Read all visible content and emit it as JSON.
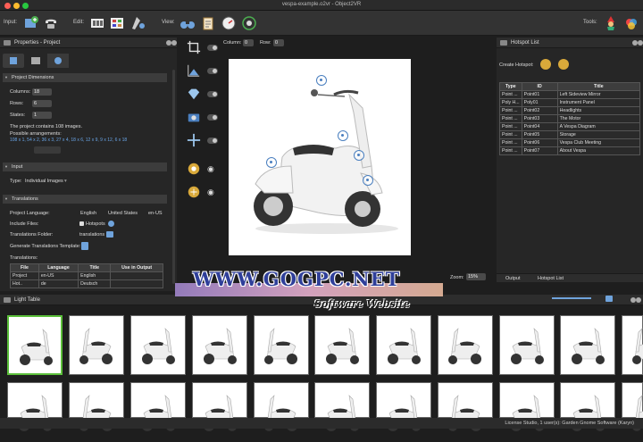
{
  "window": {
    "title": "vespa-example.o2vr - Object2VR"
  },
  "toolbar": {
    "input_label": "Input:",
    "edit_label": "Edit:",
    "view_label": "View:",
    "tools_label": "Tools:"
  },
  "properties": {
    "panel_title": "Properties - Project",
    "dimensions": {
      "heading": "Project Dimensions",
      "columns_label": "Columns:",
      "columns_value": "18",
      "rows_label": "Rows:",
      "rows_value": "6",
      "states_label": "States:",
      "states_value": "1",
      "count_text": "The project contains 108 images.",
      "arrangements_label": "Possible arrangements:",
      "arrangements": "108 x 1, 54 x 2, 36 x 3, 27 x 4, 18 x 6, 12 x 9, 9 x 12, 6 x 18"
    },
    "input": {
      "heading": "Input",
      "type_label": "Type:",
      "type_value": "Individual Images"
    },
    "translations": {
      "heading": "Translations",
      "language_label": "Project Language:",
      "language_value": "English",
      "country_value": "United States",
      "locale_value": "en-US",
      "include_label": "Include Files:",
      "include_value": "Hotspots",
      "folder_label": "Translations Folder:",
      "folder_value": "translations",
      "template_label": "Generate Translations Template:",
      "table_label": "Translations:",
      "columns": [
        "File",
        "Language",
        "Title",
        "Use in Output"
      ],
      "rows": [
        [
          "Project",
          "en-US",
          "English",
          ""
        ],
        [
          "Hot..",
          "de",
          "Deutsch",
          ""
        ]
      ]
    }
  },
  "viewer": {
    "columns_label": "Column:",
    "columns_value": "0",
    "row_label": "Row:",
    "row_value": "0",
    "zoom_label": "Zoom:",
    "zoom_value": "15%"
  },
  "hotspots": {
    "panel_title": "Hotspot List",
    "create_label": "Create Hotspot:",
    "columns": [
      "Type",
      "ID",
      "Title"
    ],
    "rows": [
      [
        "Point ...",
        "Point01",
        "Left Sideview Mirror"
      ],
      [
        "Poly H...",
        "Poly01",
        "Instrument Panel"
      ],
      [
        "Point ...",
        "Point02",
        "Headlights"
      ],
      [
        "Point ...",
        "Point03",
        "The Motor"
      ],
      [
        "Point ...",
        "Point04",
        "A Vespa Diagram"
      ],
      [
        "Point ...",
        "Point05",
        "Storage"
      ],
      [
        "Point ...",
        "Point06",
        "Vespa Club Meeting"
      ],
      [
        "Point ...",
        "Point07",
        "About Vespa"
      ]
    ],
    "tabs": [
      "Output",
      "Hotspot List"
    ]
  },
  "lighttable": {
    "panel_title": "Light Table"
  },
  "status": {
    "text": "License Studio, 1 user(s): Garden Gnome Software (Karyn)"
  },
  "watermark": {
    "main": "WWW.GOGPC.NET",
    "sub": "Software Website"
  },
  "colors": {
    "accent": "#4a7fbf",
    "selected_thumb": "#5bbf3a",
    "link": "#6aa6e8"
  }
}
